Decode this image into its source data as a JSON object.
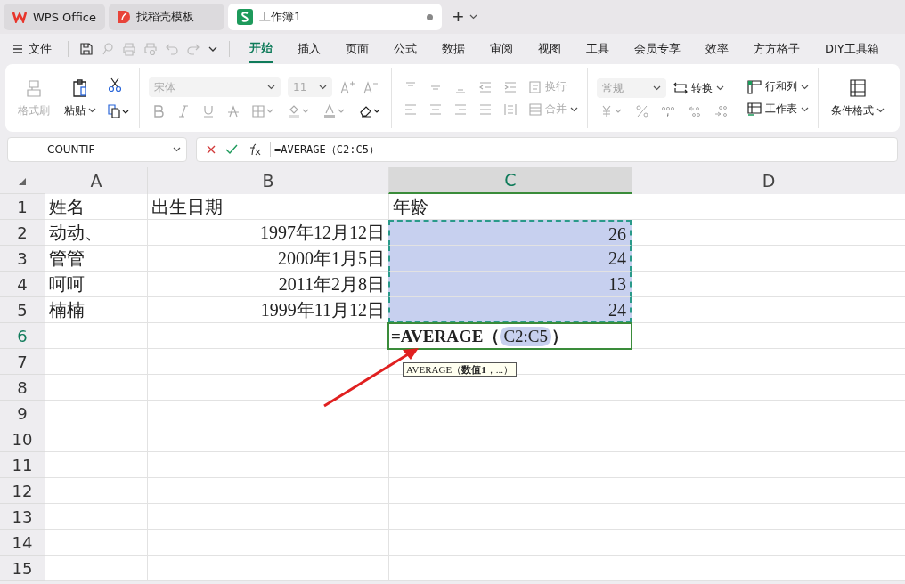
{
  "app_tabs": [
    {
      "label": "WPS Office",
      "selected": false
    },
    {
      "label": "找稻壳模板",
      "selected": false
    },
    {
      "label": "工作簿1",
      "selected": true
    }
  ],
  "new_tab": "+",
  "menu": {
    "file": "文件",
    "tabs": [
      {
        "label": "开始",
        "selected": true
      },
      {
        "label": "插入",
        "selected": false
      },
      {
        "label": "页面",
        "selected": false
      },
      {
        "label": "公式",
        "selected": false
      },
      {
        "label": "数据",
        "selected": false
      },
      {
        "label": "审阅",
        "selected": false
      },
      {
        "label": "视图",
        "selected": false
      },
      {
        "label": "工具",
        "selected": false
      },
      {
        "label": "会员专享",
        "selected": false
      },
      {
        "label": "效率",
        "selected": false
      },
      {
        "label": "方方格子",
        "selected": false
      },
      {
        "label": "DIY工具箱",
        "selected": false
      }
    ]
  },
  "ribbon": {
    "clipboard": {
      "format_painter": {
        "label": "格式刷",
        "disabled": true
      },
      "paste": {
        "label": "粘贴",
        "disabled": false
      }
    },
    "font": {
      "family": "宋体",
      "size": "11",
      "disabled": true
    },
    "alignment": {
      "wrap": "换行",
      "merge": "合并",
      "disabled": true
    },
    "number": {
      "format": "常规",
      "format_disabled": true,
      "convert": "转换",
      "symbols_disabled": true
    },
    "cells": {
      "rows_columns": "行和列",
      "worksheet": "工作表"
    },
    "styles": {
      "conditional_format": "条件格式"
    }
  },
  "formula_bar": {
    "name_box": "COUNTIF",
    "formula": "=AVERAGE（C2:C5）"
  },
  "grid": {
    "columns": [
      {
        "label": "A",
        "selected": false
      },
      {
        "label": "B",
        "selected": false
      },
      {
        "label": "C",
        "selected": true
      },
      {
        "label": "D",
        "selected": false
      }
    ],
    "rows": [
      {
        "label": "1",
        "active": false,
        "cells": [
          {
            "text": "姓名",
            "in_range": false
          },
          {
            "text": "出生日期",
            "in_range": false
          },
          {
            "text": "年龄",
            "in_range": false
          }
        ]
      },
      {
        "label": "2",
        "active": false,
        "cells": [
          {
            "text": "动动、",
            "in_range": false
          },
          {
            "text": "1997年12月12日",
            "in_range": false
          },
          {
            "text": "26",
            "in_range": true
          }
        ]
      },
      {
        "label": "3",
        "active": false,
        "cells": [
          {
            "text": "管管",
            "in_range": false
          },
          {
            "text": "2000年1月5日",
            "in_range": false
          },
          {
            "text": "24",
            "in_range": true
          }
        ]
      },
      {
        "label": "4",
        "active": false,
        "cells": [
          {
            "text": "呵呵",
            "in_range": false
          },
          {
            "text": "2011年2月8日",
            "in_range": false
          },
          {
            "text": "13",
            "in_range": true
          }
        ]
      },
      {
        "label": "5",
        "active": false,
        "cells": [
          {
            "text": "楠楠",
            "in_range": false
          },
          {
            "text": "1999年11月12日",
            "in_range": false
          },
          {
            "text": "24",
            "in_range": true
          }
        ]
      },
      {
        "label": "6",
        "active": true,
        "cells": [],
        "editor": {
          "before": "=AVERAGE（",
          "reference": "C2:C5",
          "after": "）",
          "tooltip": "AVERAGE（**数值1**，...）"
        }
      },
      {
        "label": "7",
        "active": false,
        "cells": []
      },
      {
        "label": "8",
        "active": false,
        "cells": []
      },
      {
        "label": "9",
        "active": false,
        "cells": []
      },
      {
        "label": "10",
        "active": false,
        "cells": []
      },
      {
        "label": "11",
        "active": false,
        "cells": []
      },
      {
        "label": "12",
        "active": false,
        "cells": []
      },
      {
        "label": "13",
        "active": false,
        "cells": []
      },
      {
        "label": "14",
        "active": false,
        "cells": []
      },
      {
        "label": "15",
        "active": false,
        "cells": []
      }
    ]
  }
}
